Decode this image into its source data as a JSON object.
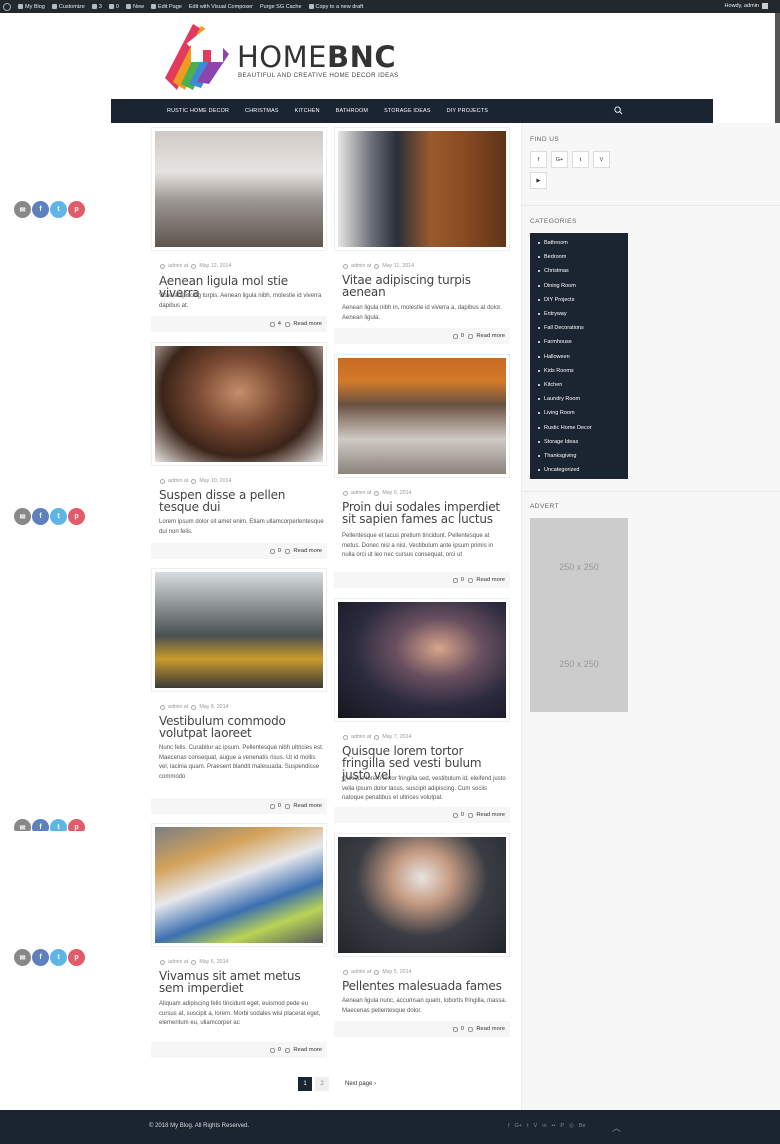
{
  "admin_bar": {
    "items": [
      "My Blog",
      "Customize",
      "3",
      "0",
      "New",
      "Edit Page",
      "Edit with Visual Composer",
      "Purge SG Cache",
      "Copy to a new draft"
    ],
    "greeting": "Howdy, admin"
  },
  "site": {
    "brand_light": "HOME",
    "brand_bold": "BNC",
    "tagline": "BEAUTIFUL AND CREATIVE HOME DECOR IDEAS"
  },
  "nav": {
    "items": [
      "RUSTIC HOME DECOR",
      "CHRISTMAS",
      "KITCHEN",
      "BATHROOM",
      "STORAGE IDEAS",
      "DIY PROJECTS"
    ],
    "search_icon": "search-icon"
  },
  "posts": [
    {
      "author": "admin at",
      "date": "May 12, 2014",
      "title": "Aenean ligula mol stie viverra",
      "excerpt": "Vitae adipiscing turpis. Aenean ligula nibh, molestie id viverra dapibus at.",
      "comments": "4",
      "read_more": "Read more"
    },
    {
      "author": "admin at",
      "date": "May 11, 2014",
      "title": "Vitae adipiscing turpis aenean",
      "excerpt": "Aenean ligula nibh in, molestie id viverra a, dapibus at dolor. Aenean ligula.",
      "comments": "0",
      "read_more": "Read more"
    },
    {
      "author": "admin at",
      "date": "May 10, 2014",
      "title": "Suspen disse a pellen tesque dui",
      "excerpt": "Lorem ipsum dolor sit amet enim. Etiam ullamcorperlentesque dui non felis.",
      "comments": "0",
      "read_more": "Read more"
    },
    {
      "author": "admin at",
      "date": "May 9, 2014",
      "title": "Proin dui sodales imperdiet sit sapien fames ac luctus",
      "excerpt": "Pellentesque et lacus pretium tincidunt. Pellentesque at metus. Donec nisl a nisl. Vestibulum ante ipsum primis in nulla orci ut leo nec cursus consequat, orci ut",
      "comments": "0",
      "read_more": "Read more"
    },
    {
      "author": "admin at",
      "date": "May 8, 2014",
      "title": "Vestibulum commodo volutpat laoreet",
      "excerpt": "Nunc felis. Curabitur ac ipsum. Pellentesque nibh ultricies est. Maecenas consequat, augue a venenatis risus. Ut id mollis vel, lacinia quam. Praesent blandit malesuada. Suspendisse commodo",
      "comments": "0",
      "read_more": "Read more"
    },
    {
      "author": "admin at",
      "date": "May 7, 2014",
      "title": "Quisque lorem tortor fringilla sed vesti bulum justo vel",
      "excerpt": "Quisque lorem tortor fringilla sed, vestibulum id, eleifend justo vella ipsum dolor lacus, suscipit adipiscing. Cum sociis natoque penatibus et ultrices volutpat.",
      "comments": "0",
      "read_more": "Read more"
    },
    {
      "author": "admin at",
      "date": "May 6, 2014",
      "title": "Vivamus sit amet metus sem imperdiet",
      "excerpt": "Aliquam adipiscing felis tincidunt eget, euismod pede eu cursus at, suscipit a, lorem. Morbi sodales wisi placerat eget, elementum eu, ullamcorper ac",
      "comments": "0",
      "read_more": "Read more"
    },
    {
      "author": "admin at",
      "date": "May 5, 2014",
      "title": "Pellentes malesuada fames",
      "excerpt": "Aenean ligula nunc, accumsan quam, lobortis fringilla, massa. Maecenas pellentesque dolor.",
      "comments": "0",
      "read_more": "Read more"
    }
  ],
  "sidebar": {
    "find_us": "FIND US",
    "social": [
      "f",
      "G+",
      "t",
      "V",
      "▶"
    ],
    "categories_title": "CATEGORIES",
    "categories": [
      "Bathroom",
      "Bedroom",
      "Christmas",
      "Dining Room",
      "DIY Projects",
      "Entryway",
      "Fall Decorations",
      "Farmhouse",
      "Halloween",
      "Kids Rooms",
      "Kitchen",
      "Laundry Room",
      "Living Room",
      "Rustic Home Decor",
      "Storage Ideas",
      "Thanksgiving",
      "Uncategorized"
    ],
    "advert_title": "ADVERT",
    "adverts": [
      "250 x 250",
      "250 x 250"
    ]
  },
  "pagination": {
    "current": "1",
    "other": "2",
    "next": "Next page ›"
  },
  "footer": {
    "copyright": "© 2018 My Blog. All Rights Reserved.",
    "social": [
      "f",
      "G+",
      "t",
      "V",
      "in",
      "••",
      "P",
      "◎",
      "Be"
    ],
    "up": "︿"
  },
  "colors": {
    "navy": "#1b2431",
    "share_fb": "#5e80bf",
    "share_tw": "#5fb5e6",
    "share_pin": "#e05c6b"
  }
}
